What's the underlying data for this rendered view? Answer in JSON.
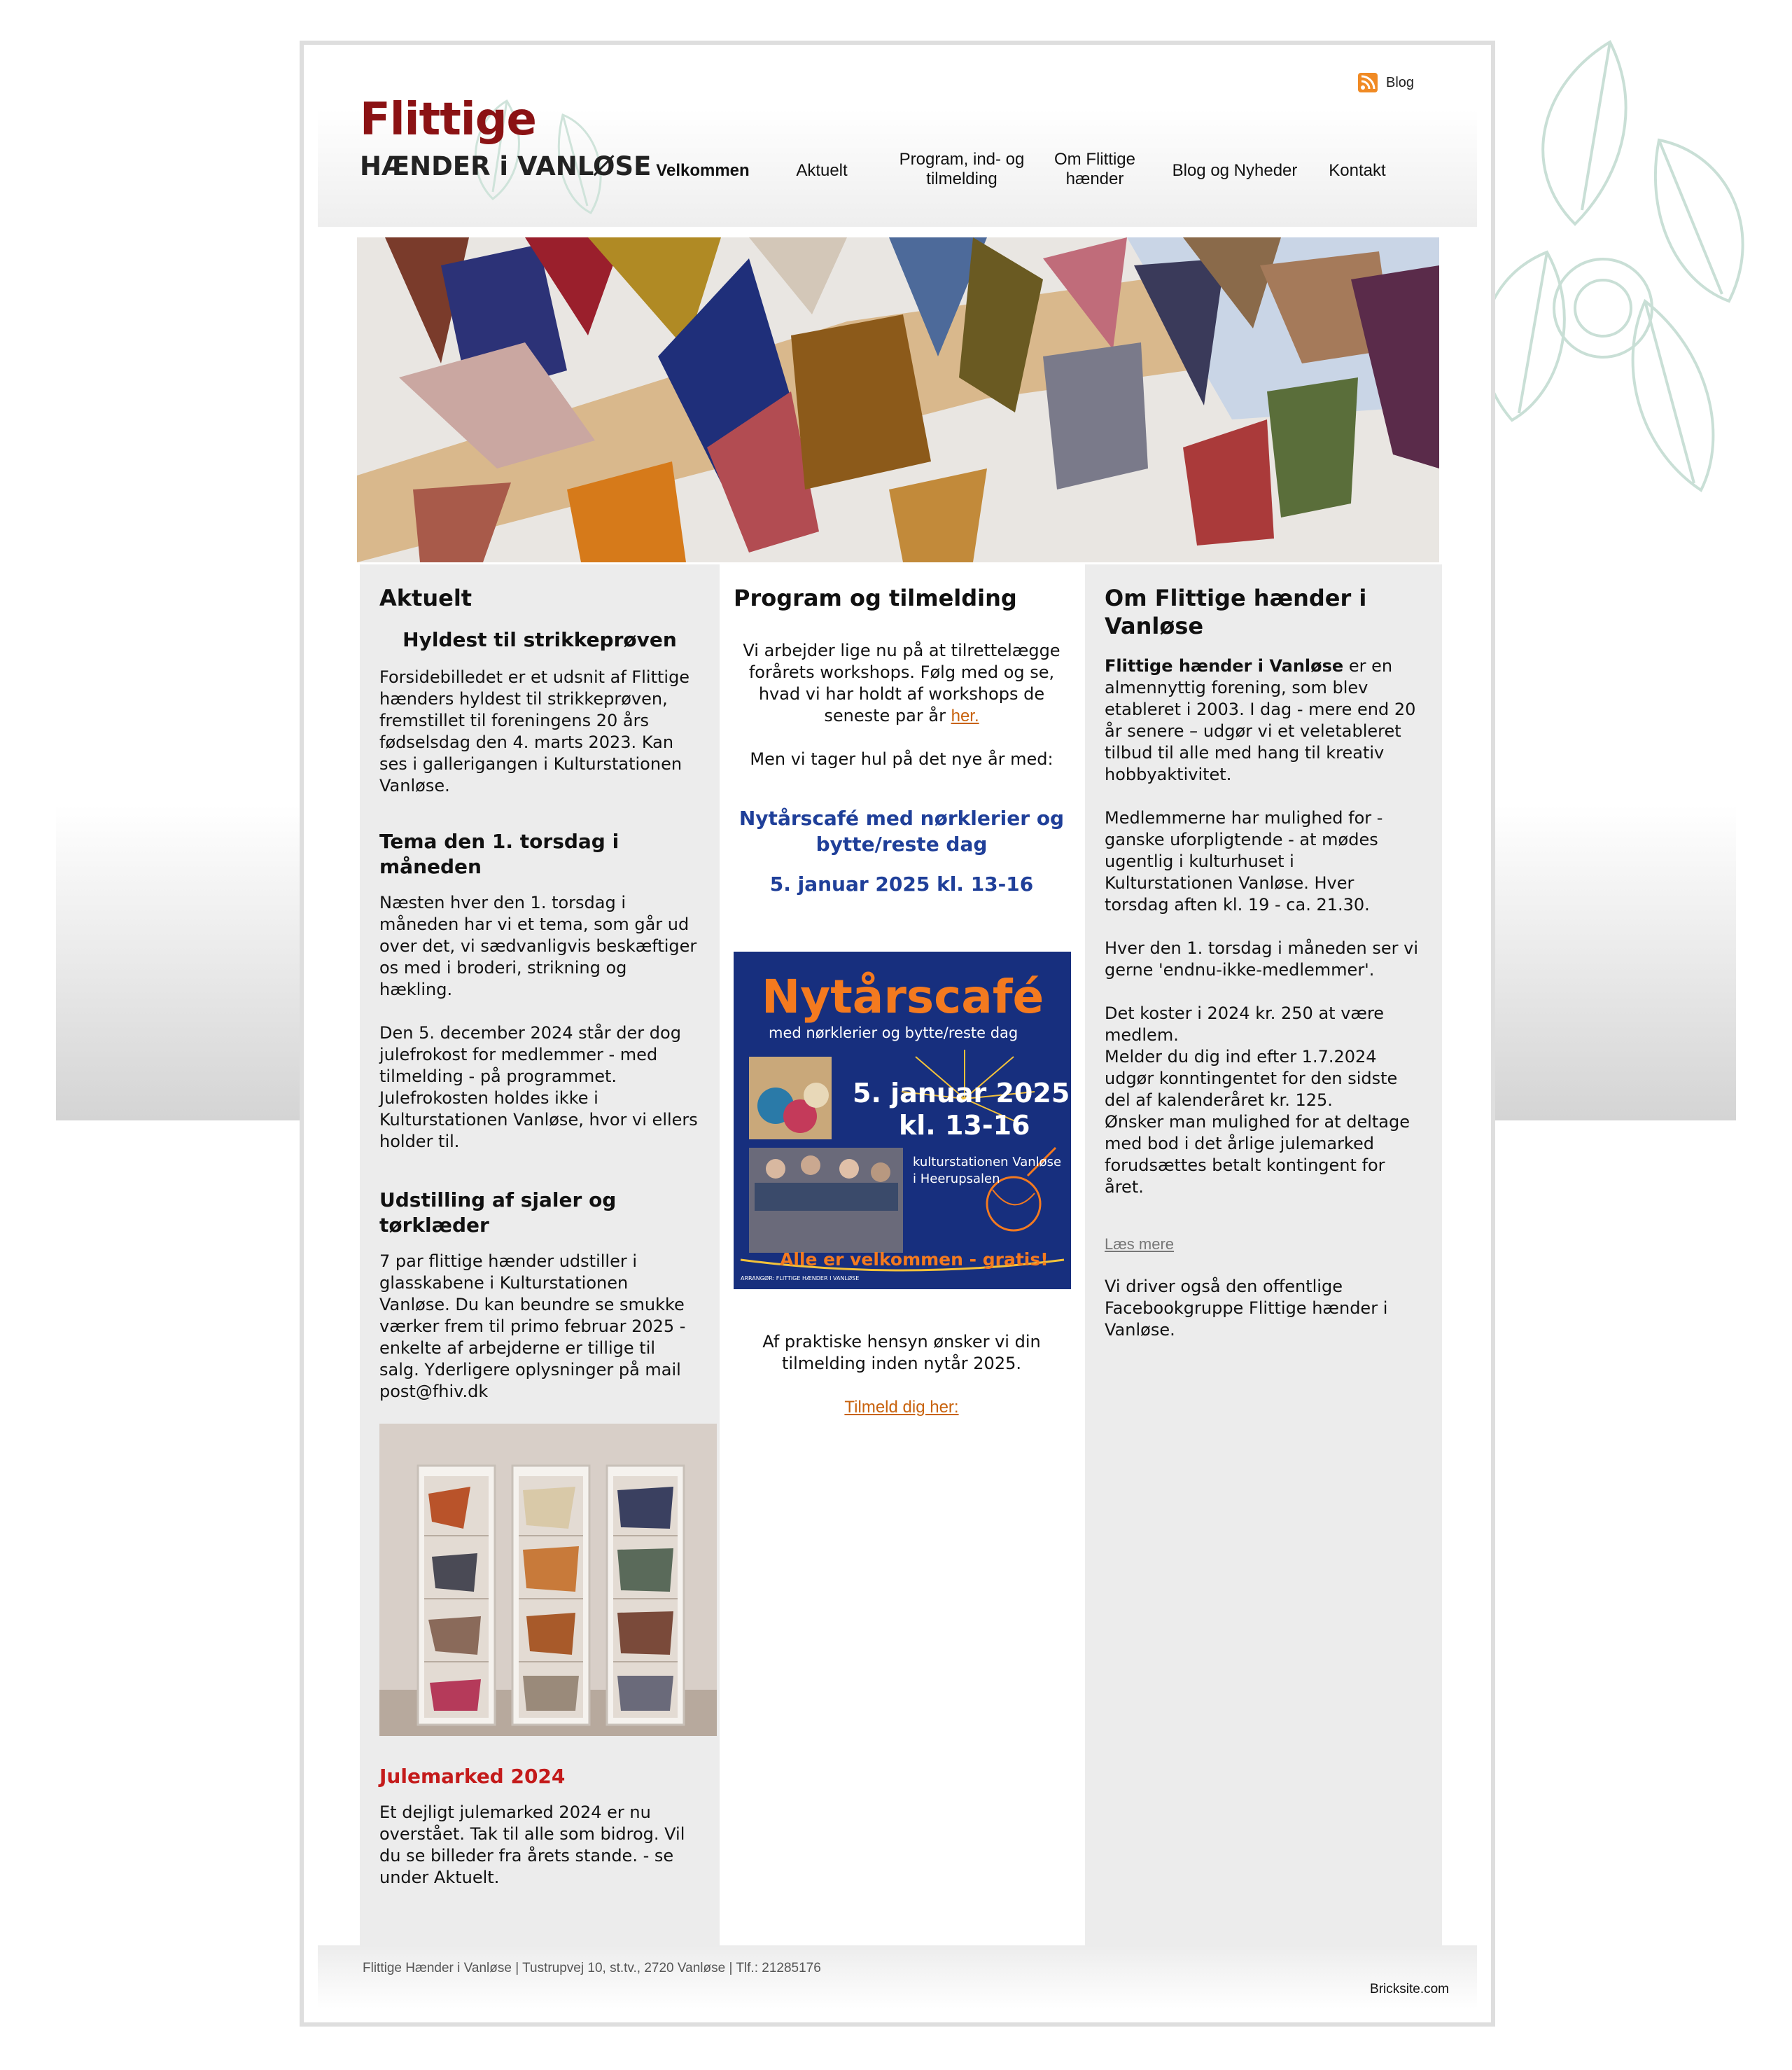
{
  "header": {
    "logo_line1": "Flittige",
    "logo_line2": "HÆNDER i VANLØSE",
    "blog_link": "Blog"
  },
  "nav": {
    "items": [
      {
        "label": "Velkommen",
        "active": true
      },
      {
        "label": "Aktuelt",
        "active": false
      },
      {
        "label": "Program, ind- og tilmelding",
        "active": false
      },
      {
        "label": "Om Flittige hænder",
        "active": false
      },
      {
        "label": "Blog og Nyheder",
        "active": false
      },
      {
        "label": "Kontakt",
        "active": false
      }
    ]
  },
  "left": {
    "title": "Aktuelt",
    "s1_title": "Hyldest til strikkeprøven",
    "s1_text": "Forsidebilledet er et udsnit af Flittige hænders hyldest til strikkeprøven, fremstillet til foreningens 20 års fødselsdag den 4. marts 2023. Kan ses i gallerigangen i Kulturstationen Vanløse.",
    "s2_title": "Tema den 1. torsdag i måneden",
    "s2_text1": "Næsten hver den 1. torsdag i måneden har vi et tema, som går ud over det, vi sædvanligvis beskæftiger os med i broderi, strikning og hækling.",
    "s2_text2": "Den 5. december 2024 står der dog julefrokost for medlemmer - med tilmelding - på programmet. Julefrokosten holdes ikke i Kulturstationen Vanløse, hvor vi ellers holder til.",
    "s3_title": "Udstilling af sjaler og tørklæder",
    "s3_text": "7 par flittige hænder udstiller i glasskabene i Kulturstationen Vanløse. Du kan beundre se smukke værker frem til primo februar 2025 - enkelte af arbejderne er tillige til salg. Yderligere oplysninger på mail post@fhiv.dk",
    "s4_title": "Julemarked 2024",
    "s4_text": "Et dejligt julemarked 2024 er nu overstået. Tak til alle som bidrog. Vil du se billeder fra årets stande. - se under Aktuelt."
  },
  "mid": {
    "title": "Program og tilmelding",
    "text1": "Vi arbejder lige nu på at tilrettelægge forårets workshops. Følg med og se, hvad vi har holdt af workshops de seneste par år",
    "link_her": "her.",
    "text2": "Men vi tager hul på det nye år med:",
    "event_title": "Nytårscafé med nørklerier og bytte/reste dag",
    "event_date": "5. januar 2025 kl. 13-16",
    "poster": {
      "title": "Nytårscafé",
      "subtitle": "med nørklerier og bytte/reste dag",
      "date1": "5. januar 2025",
      "date2": "kl. 13-16",
      "place1": "kulturstationen Vanløse",
      "place2": "i Heerupsalen",
      "welcome": "Alle er velkommen - gratis!",
      "arranger": "ARRANGØR: FLITTIGE HÆNDER I VANLØSE"
    },
    "text3": "Af praktiske hensyn ønsker vi din tilmelding inden nytår 2025.",
    "signup_link": "Tilmeld dig her:"
  },
  "right": {
    "title": "Om Flittige hænder i Vanløse",
    "p1_bold": "Flittige hænder i Vanløse",
    "p1_rest": " er en almennyttig forening, som blev etableret i 2003. I dag - mere end 20 år senere – udgør vi et veletableret tilbud til alle med hang til kreativ hobbyaktivitet.",
    "p2": "Medlemmerne har mulighed for - ganske uforpligtende - at mødes ugentlig i kulturhuset i Kulturstationen Vanløse. Hver torsdag aften kl. 19 - ca. 21.30.",
    "p3": "Hver den 1. torsdag i måneden ser vi gerne 'endnu-ikke-medlemmer'.",
    "p4": "Det koster i 2024 kr. 250 at være medlem.",
    "p5": "Melder du dig ind efter 1.7.2024 udgør konntingentet for den sidste del af kalenderåret kr. 125.",
    "p6": "Ønsker man mulighed for at deltage med bod i det årlige julemarked forudsættes betalt kontingent for året.",
    "read_more": "Læs mere",
    "p7": "Vi driver også den offentlige Facebookgruppe Flittige hænder i Vanløse."
  },
  "footer": {
    "text": "Flittige Hænder i Vanløse | Tustrupvej 10, st.tv., 2720 Vanløse  | Tlf.: 21285176",
    "brand": "Bricksite.com"
  },
  "colors": {
    "logo_red": "#8b1214",
    "link_orange": "#c8620c",
    "event_blue": "#1f3f99",
    "julemarked_red": "#c41a1a",
    "column_gray": "#ececec"
  }
}
